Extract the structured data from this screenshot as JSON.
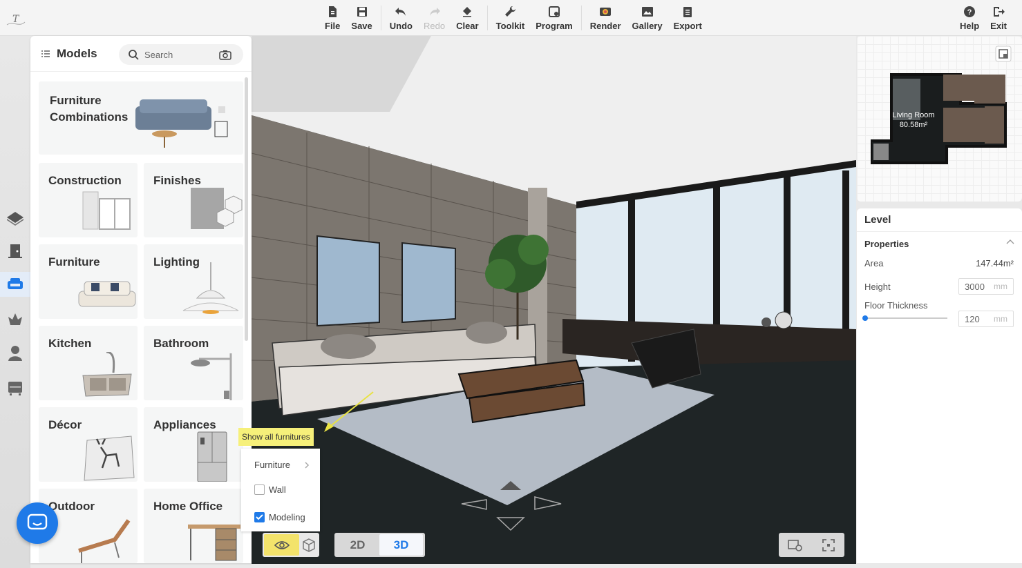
{
  "toolbar": {
    "logo_text": "T",
    "items": [
      {
        "label": "File",
        "icon": "file-icon"
      },
      {
        "label": "Save",
        "icon": "save-icon"
      },
      {
        "label": "Undo",
        "icon": "undo-icon"
      },
      {
        "label": "Redo",
        "icon": "redo-icon"
      },
      {
        "label": "Clear",
        "icon": "clear-icon"
      },
      {
        "label": "Toolkit",
        "icon": "toolkit-icon"
      },
      {
        "label": "Program",
        "icon": "program-icon"
      },
      {
        "label": "Render",
        "icon": "render-icon"
      },
      {
        "label": "Gallery",
        "icon": "gallery-icon"
      },
      {
        "label": "Export",
        "icon": "export-icon"
      }
    ],
    "help_label": "Help",
    "exit_label": "Exit"
  },
  "models_panel": {
    "title": "Models",
    "search_placeholder": "Search",
    "categories": [
      {
        "label": "Furniture\nCombinations"
      },
      {
        "label": "Construction"
      },
      {
        "label": "Finishes"
      },
      {
        "label": "Furniture"
      },
      {
        "label": "Lighting"
      },
      {
        "label": "Kitchen"
      },
      {
        "label": "Bathroom"
      },
      {
        "label": "Décor"
      },
      {
        "label": "Appliances"
      },
      {
        "label": "Outdoor"
      },
      {
        "label": "Home Office"
      }
    ]
  },
  "minimap": {
    "room_name": "Living Room",
    "room_area": "80.58m²"
  },
  "properties": {
    "level_title": "Level",
    "section_title": "Properties",
    "area_label": "Area",
    "area_value": "147.44m²",
    "height_label": "Height",
    "height_value": "3000",
    "height_unit": "mm",
    "floor_thickness_label": "Floor Thickness",
    "floor_thickness_value": "120",
    "floor_thickness_unit": "mm",
    "floor_thickness_slider_fraction": 0.0
  },
  "visibility_popup": {
    "tooltip": "Show all furnitures",
    "items": [
      {
        "label": "Furniture",
        "type": "submenu"
      },
      {
        "label": "Wall",
        "type": "checkbox",
        "checked": false
      },
      {
        "label": "Modeling",
        "type": "checkbox",
        "checked": true
      }
    ]
  },
  "view_mode": {
    "options": [
      "2D",
      "3D"
    ],
    "selected": "3D"
  },
  "colors": {
    "accent": "#1f7ae8",
    "tooltip_bg": "#f6f07a",
    "scene_floor": "#1f2526"
  }
}
